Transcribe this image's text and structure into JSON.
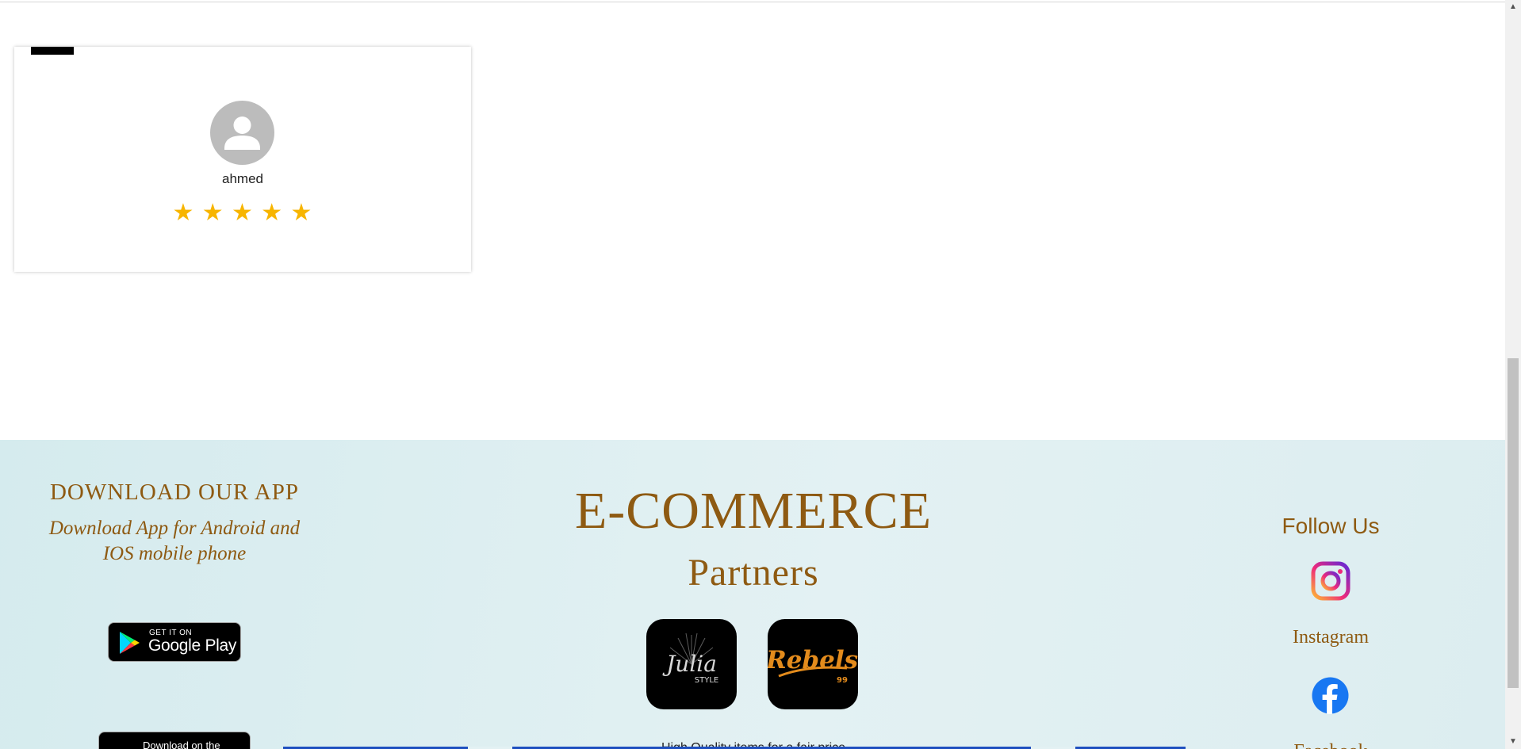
{
  "review": {
    "reviewer_name": "ahmed",
    "rating": 5,
    "stars": [
      "★",
      "★",
      "★",
      "★",
      "★"
    ]
  },
  "footer": {
    "download": {
      "title": "DOWNLOAD OUR APP",
      "subtitle": "Download App for Android and IOS mobile phone",
      "google_play": {
        "small": "GET IT ON",
        "big": "Google Play"
      },
      "app_store": {
        "small": "Download on the"
      }
    },
    "brand": "E-COMMERCE",
    "partners_title": "Partners",
    "partners": [
      {
        "name": "Julia",
        "sub": "STYLE"
      },
      {
        "name": "Rebels",
        "sub": "99"
      }
    ],
    "bottom_text": "High Quality items for a fair price",
    "follow": {
      "title": "Follow Us",
      "instagram": "Instagram",
      "facebook": "Facebook"
    }
  },
  "colors": {
    "accent": "#8e5a12",
    "star": "#f7b500",
    "footer_bg": "#dcedf0",
    "facebook": "#1877f2"
  }
}
